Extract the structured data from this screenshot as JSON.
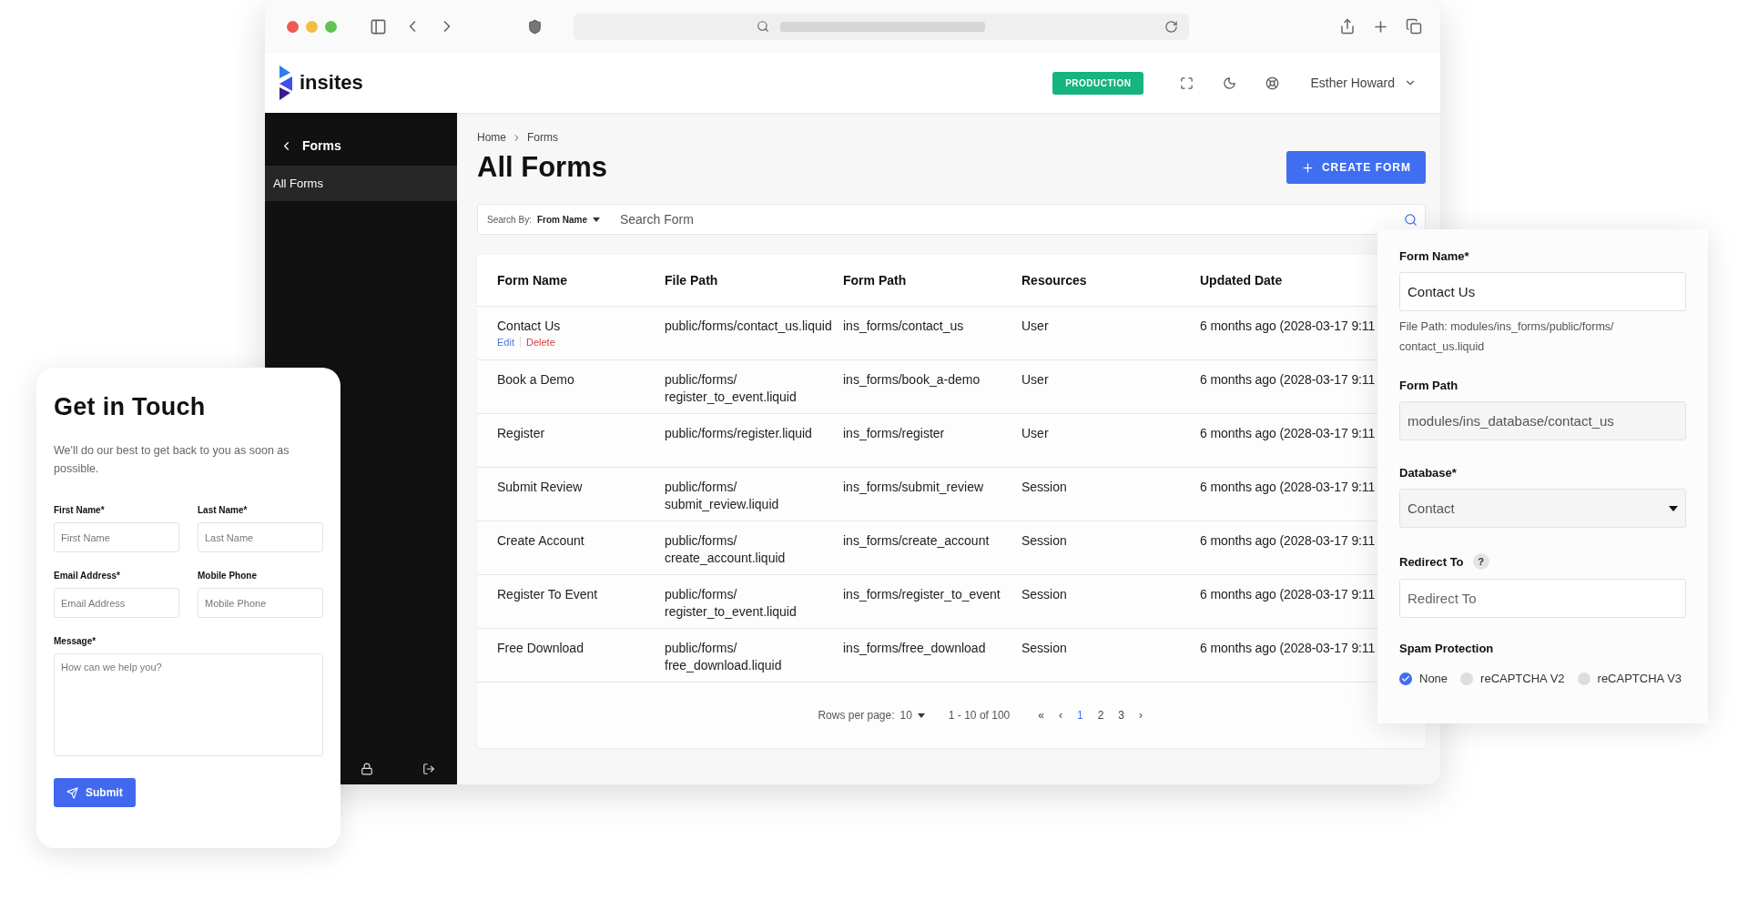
{
  "header": {
    "logo": "insites",
    "environment": "PRODUCTION",
    "user": "Esther Howard"
  },
  "sidebar": {
    "title": "Forms",
    "items": [
      {
        "label": "All Forms",
        "selected": true
      }
    ]
  },
  "breadcrumb": [
    "Home",
    "Forms"
  ],
  "page_title": "All Forms",
  "create_button": "CREATE FORM",
  "search": {
    "by_label": "Search By:",
    "by_value": "From Name",
    "placeholder": "Search Form"
  },
  "table": {
    "columns": [
      "Form Name",
      "File Path",
      "Form Path",
      "Resources",
      "Updated Date"
    ],
    "rows": [
      {
        "cells": [
          "Contact Us",
          "public/forms/contact_us.liquid",
          "ins_forms/contact_us",
          "User",
          "6 months ago (2028-03-17 9:11"
        ],
        "actions": [
          {
            "label": "Edit",
            "kind": "edit"
          },
          {
            "label": "Delete",
            "kind": "danger"
          }
        ]
      },
      {
        "cells": [
          "Book a Demo",
          "public/forms/register_to_event.liquid",
          "ins_forms/book_a-demo",
          "User",
          "6 months ago (2028-03-17 9:11"
        ]
      },
      {
        "cells": [
          "Register",
          "public/forms/register.liquid",
          "ins_forms/register",
          "User",
          "6 months ago (2028-03-17 9:11"
        ]
      },
      {
        "cells": [
          "Submit Review",
          "public/forms/submit_review.liquid",
          "ins_forms/submit_review",
          "Session",
          "6 months ago (2028-03-17 9:11"
        ]
      },
      {
        "cells": [
          "Create Account",
          "public/forms/create_account.liquid",
          "ins_forms/create_account",
          "Session",
          "6 months ago (2028-03-17 9:11"
        ]
      },
      {
        "cells": [
          "Register To Event",
          "public/forms/register_to_event.liquid",
          "ins_forms/register_to_event",
          "Session",
          "6 months ago (2028-03-17 9:11"
        ]
      },
      {
        "cells": [
          "Free Download",
          "public/forms/free_download.liquid",
          "ins_forms/free_download",
          "Session",
          "6 months ago (2028-03-17 9:11"
        ]
      }
    ]
  },
  "pagination": {
    "rows_label": "Rows per page:",
    "rows_value": "10",
    "range": "1 - 10 of 100",
    "first": "«",
    "prev": "‹",
    "next": "›",
    "pages": [
      {
        "label": "1",
        "selected": true
      },
      {
        "label": "2",
        "selected": false
      },
      {
        "label": "3",
        "selected": false
      }
    ]
  },
  "contact_card": {
    "title": "Get in Touch",
    "subtitle": "We'll do our best to get back to you as soon as possible.",
    "fields": [
      {
        "label": "First Name*",
        "placeholder": "First Name"
      },
      {
        "label": "Last Name*",
        "placeholder": "Last Name"
      },
      {
        "label": "Email Address*",
        "placeholder": "Email Address"
      },
      {
        "label": "Mobile Phone",
        "placeholder": "Mobile Phone"
      }
    ],
    "message": {
      "label": "Message*",
      "placeholder": "How can we help you?"
    },
    "submit": "Submit"
  },
  "settings_panel": {
    "form_name": {
      "label": "Form Name*",
      "value": "Contact Us"
    },
    "file_path_note": "File Path: modules/ins_forms/public/forms/contact_us.liquid",
    "form_path": {
      "label": "Form Path",
      "value": "modules/ins_database/contact_us"
    },
    "database": {
      "label": "Database*",
      "value": "Contact"
    },
    "redirect": {
      "label": "Redirect To",
      "help": "?",
      "placeholder": "Redirect To"
    },
    "spam": {
      "label": "Spam Protection",
      "options": [
        {
          "label": "None",
          "selected": true
        },
        {
          "label": "reCAPTCHA V2",
          "selected": false
        },
        {
          "label": "reCAPTCHA V3",
          "selected": false
        }
      ]
    }
  }
}
